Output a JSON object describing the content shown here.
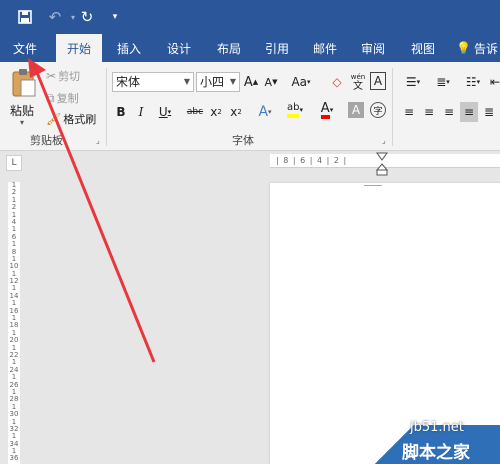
{
  "quick_access": {
    "more": "₹"
  },
  "tabs": [
    "文件",
    "开始",
    "插入",
    "设计",
    "布局",
    "引用",
    "邮件",
    "审阅",
    "视图",
    "告诉"
  ],
  "active_tab": "开始",
  "clipboard": {
    "paste": "粘贴",
    "cut": "剪切",
    "copy": "复制",
    "format_painter": "格式刷",
    "group_label": "剪贴板"
  },
  "font": {
    "name": "宋体",
    "size": "小四",
    "group_label": "字体",
    "case_label": "Aa",
    "phonetic": "wén",
    "phonetic_char": "文",
    "border_char": "A",
    "circle_char": "字"
  },
  "watermark": {
    "site": "jb51.net",
    "brand": "脚本之家"
  },
  "ruler": {
    "horizontal": "| 8 | 6 | 4 | 2 |",
    "vertical": [
      "1",
      "2",
      "1",
      "2",
      "1",
      "4",
      "1",
      "6",
      "1",
      "8",
      "1",
      "10",
      "1",
      "12",
      "1",
      "14",
      "1",
      "16",
      "1",
      "18",
      "1",
      "20",
      "1",
      "22",
      "1",
      "24",
      "1",
      "26",
      "1",
      "28",
      "1",
      "30",
      "1",
      "32",
      "1",
      "34",
      "1",
      "36"
    ]
  },
  "colors": {
    "ribbon_blue": "#2b579a",
    "arrow_red": "#e8373d",
    "highlight_yellow": "#ffff00",
    "font_red": "#ff0000"
  }
}
